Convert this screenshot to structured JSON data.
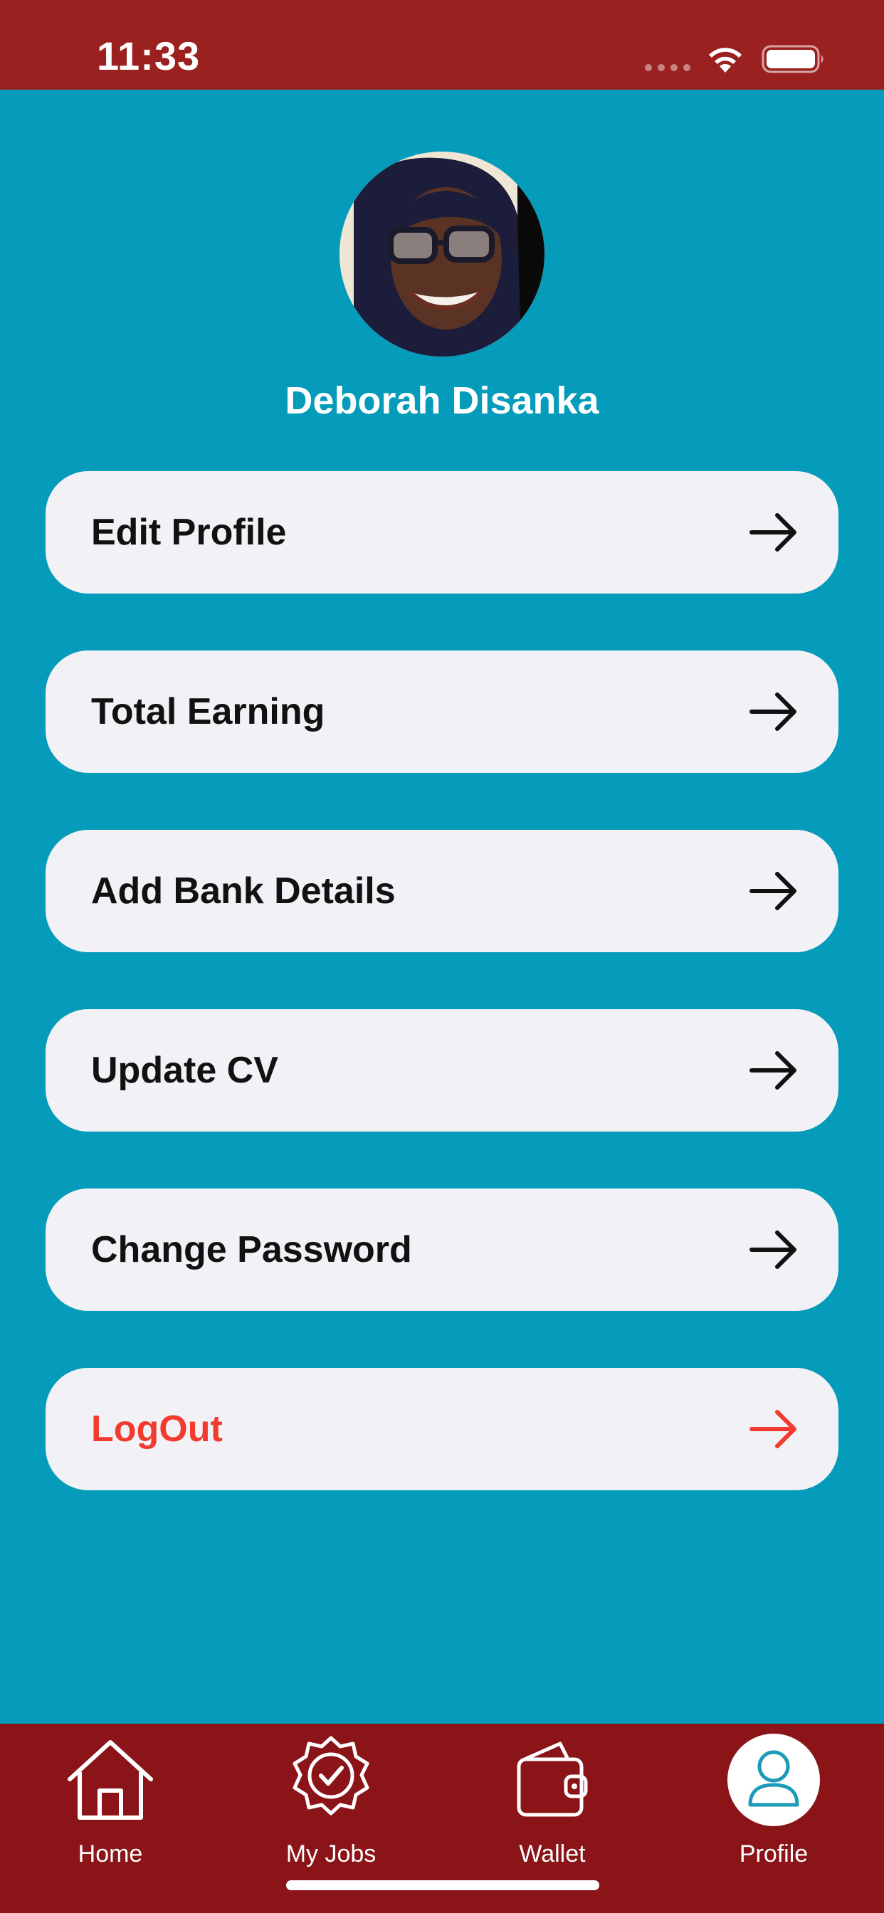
{
  "status_bar": {
    "time": "11:33"
  },
  "profile": {
    "name": "Deborah Disanka"
  },
  "menu": {
    "items": [
      {
        "label": "Edit Profile"
      },
      {
        "label": "Total Earning"
      },
      {
        "label": "Add Bank Details"
      },
      {
        "label": "Update CV"
      },
      {
        "label": "Change Password"
      },
      {
        "label": "LogOut"
      }
    ]
  },
  "tab_bar": {
    "tabs": [
      {
        "label": "Home",
        "icon": "home-icon"
      },
      {
        "label": "My Jobs",
        "icon": "badge-check-icon"
      },
      {
        "label": "Wallet",
        "icon": "wallet-icon"
      },
      {
        "label": "Profile",
        "icon": "user-icon"
      }
    ],
    "active": "Profile"
  },
  "colors": {
    "status_bar_bg": "#9b2020",
    "main_bg": "#059bba",
    "tab_bar_bg": "#8a1418",
    "menu_item_bg": "#f2f2f6",
    "logout_red": "#f23a2f"
  }
}
